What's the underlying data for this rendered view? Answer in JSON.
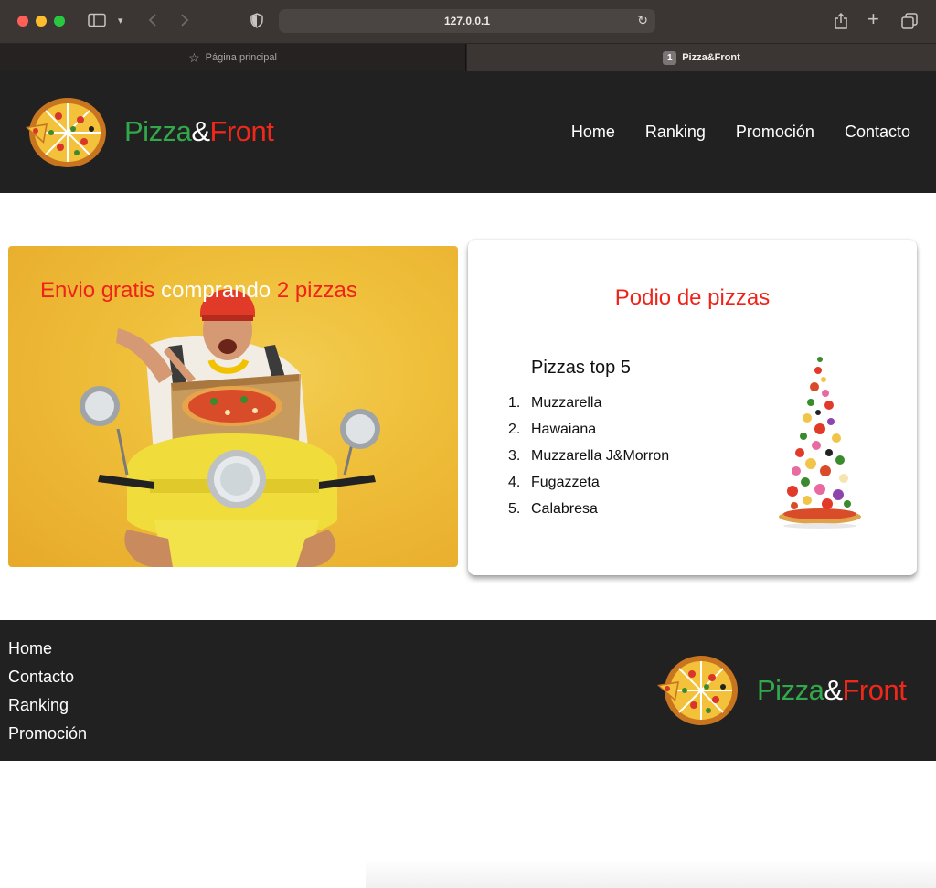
{
  "browser": {
    "url": "127.0.0.1",
    "tabs": [
      {
        "label": "Página principal",
        "icon": "star-icon"
      },
      {
        "label": "Pizza&Front",
        "badge": "1"
      }
    ]
  },
  "header": {
    "brand": {
      "part1": "Pizza",
      "part2": "&",
      "part3": "Front"
    },
    "nav": [
      "Home",
      "Ranking",
      "Promoción",
      "Contacto"
    ]
  },
  "promo": {
    "text1": "Envio gratis",
    "text2": "comprando",
    "text3": "2 pizzas"
  },
  "podio": {
    "title": "Podio de pizzas",
    "list_title": "Pizzas top 5",
    "items": [
      {
        "num": "1.",
        "name": "Muzzarella"
      },
      {
        "num": "2.",
        "name": "Hawaiana"
      },
      {
        "num": "3.",
        "name": "Muzzarella J&Morron"
      },
      {
        "num": "4.",
        "name": "Fugazzeta"
      },
      {
        "num": "5.",
        "name": "Calabresa"
      }
    ]
  },
  "footer": {
    "nav": [
      "Home",
      "Contacto",
      "Ranking",
      "Promoción"
    ],
    "brand": {
      "part1": "Pizza",
      "part2": "&",
      "part3": "Front"
    }
  },
  "colors": {
    "green": "#31a84a",
    "red": "#f0281a",
    "dark": "#222122",
    "promo_yellow": "#efbf3a"
  }
}
